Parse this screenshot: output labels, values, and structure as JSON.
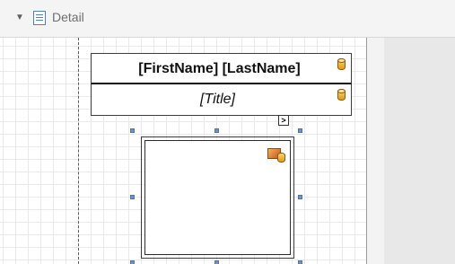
{
  "band": {
    "title": "Detail",
    "toggle_glyph": "▼",
    "icon": "detail-band-icon"
  },
  "labels": {
    "name": "[FirstName] [LastName]",
    "title": "[Title]"
  },
  "smart_tag": {
    "glyph": ">"
  },
  "icons": {
    "bound_field": "database-icon",
    "picture": "picture-box-icon"
  },
  "colors": {
    "handle": "#6f93c7",
    "band_header_bg": "#f4f4f4",
    "grid_line": "#e9e9e9"
  }
}
